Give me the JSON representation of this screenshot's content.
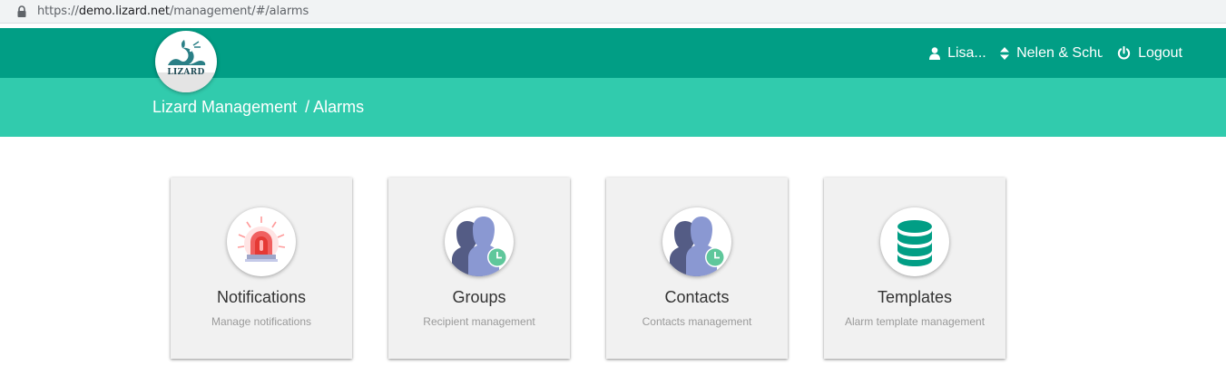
{
  "browser": {
    "url_scheme": "https://",
    "url_host": "demo.lizard.net",
    "url_path": "/management/#/alarms"
  },
  "header": {
    "logo_text": "LIZARD",
    "user_name": "Lisa...",
    "organisation": "Nelen & Schu",
    "logout_label": "Logout"
  },
  "breadcrumb": {
    "root": "Lizard Management",
    "current": "/ Alarms"
  },
  "colors": {
    "topbar": "#019e85",
    "subbar": "#31cbad"
  },
  "tiles": [
    {
      "title": "Notifications",
      "subtitle": "Manage notifications",
      "icon": "alarm-siren-icon"
    },
    {
      "title": "Groups",
      "subtitle": "Recipient management",
      "icon": "group-users-icon"
    },
    {
      "title": "Contacts",
      "subtitle": "Contacts management",
      "icon": "contacts-users-icon"
    },
    {
      "title": "Templates",
      "subtitle": "Alarm template management",
      "icon": "database-icon"
    }
  ]
}
